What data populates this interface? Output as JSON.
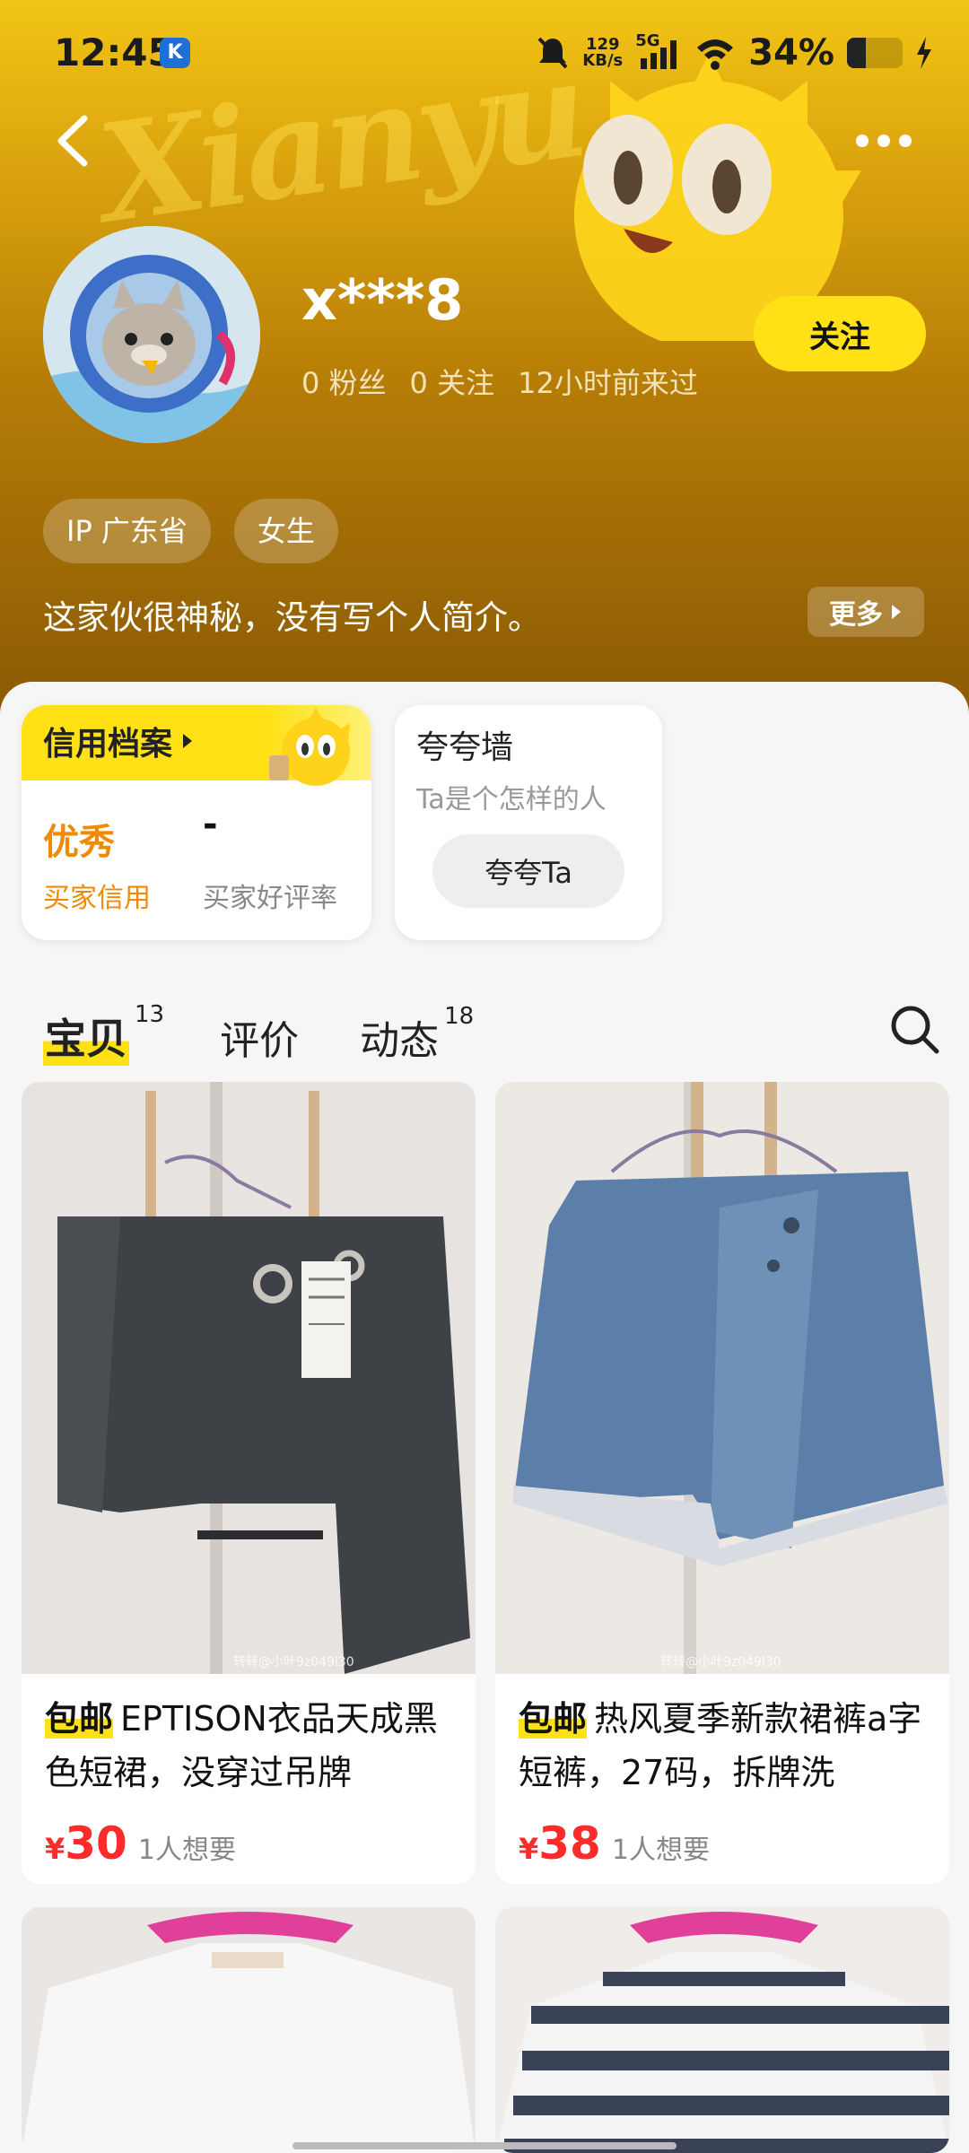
{
  "status_bar": {
    "time": "12:45",
    "app_badge": "K",
    "net_speed_value": "129",
    "net_speed_unit": "KB/s",
    "network": "5G",
    "battery_text": "34%",
    "battery_level": 0.34
  },
  "profile": {
    "username": "x***8",
    "fans": "0 粉丝",
    "following": "0 关注",
    "last_seen": "12小时前来过",
    "follow_label": "关注",
    "tags": [
      "IP 广东省",
      "女生"
    ],
    "bio": "这家伙很神秘，没有写个人简介。",
    "more_label": "更多"
  },
  "credit": {
    "title": "信用档案",
    "value": "优秀",
    "value_label": "买家信用",
    "rate_value": "-",
    "rate_label": "买家好评率"
  },
  "praise": {
    "title": "夸夸墙",
    "subtitle": "Ta是个怎样的人",
    "button": "夸夸Ta"
  },
  "tabs": [
    {
      "label": "宝贝",
      "count": "13"
    },
    {
      "label": "评价",
      "count": ""
    },
    {
      "label": "动态",
      "count": "18"
    }
  ],
  "products": [
    {
      "badge": "包邮",
      "title": "EPTISON衣品天成黑色短裙，没穿过吊牌",
      "currency": "¥",
      "price": "30",
      "wants": "1人想要",
      "watermark": "转转@小叶9z049l30"
    },
    {
      "badge": "包邮",
      "title": "热风夏季新款裙裤a字短裤，27码，拆牌洗",
      "currency": "¥",
      "price": "38",
      "wants": "1人想要",
      "watermark": "转转@小叶9z049l30"
    }
  ],
  "colors": {
    "accent": "#ffe116",
    "price": "#ff2a2a",
    "credit": "#f08a00"
  }
}
